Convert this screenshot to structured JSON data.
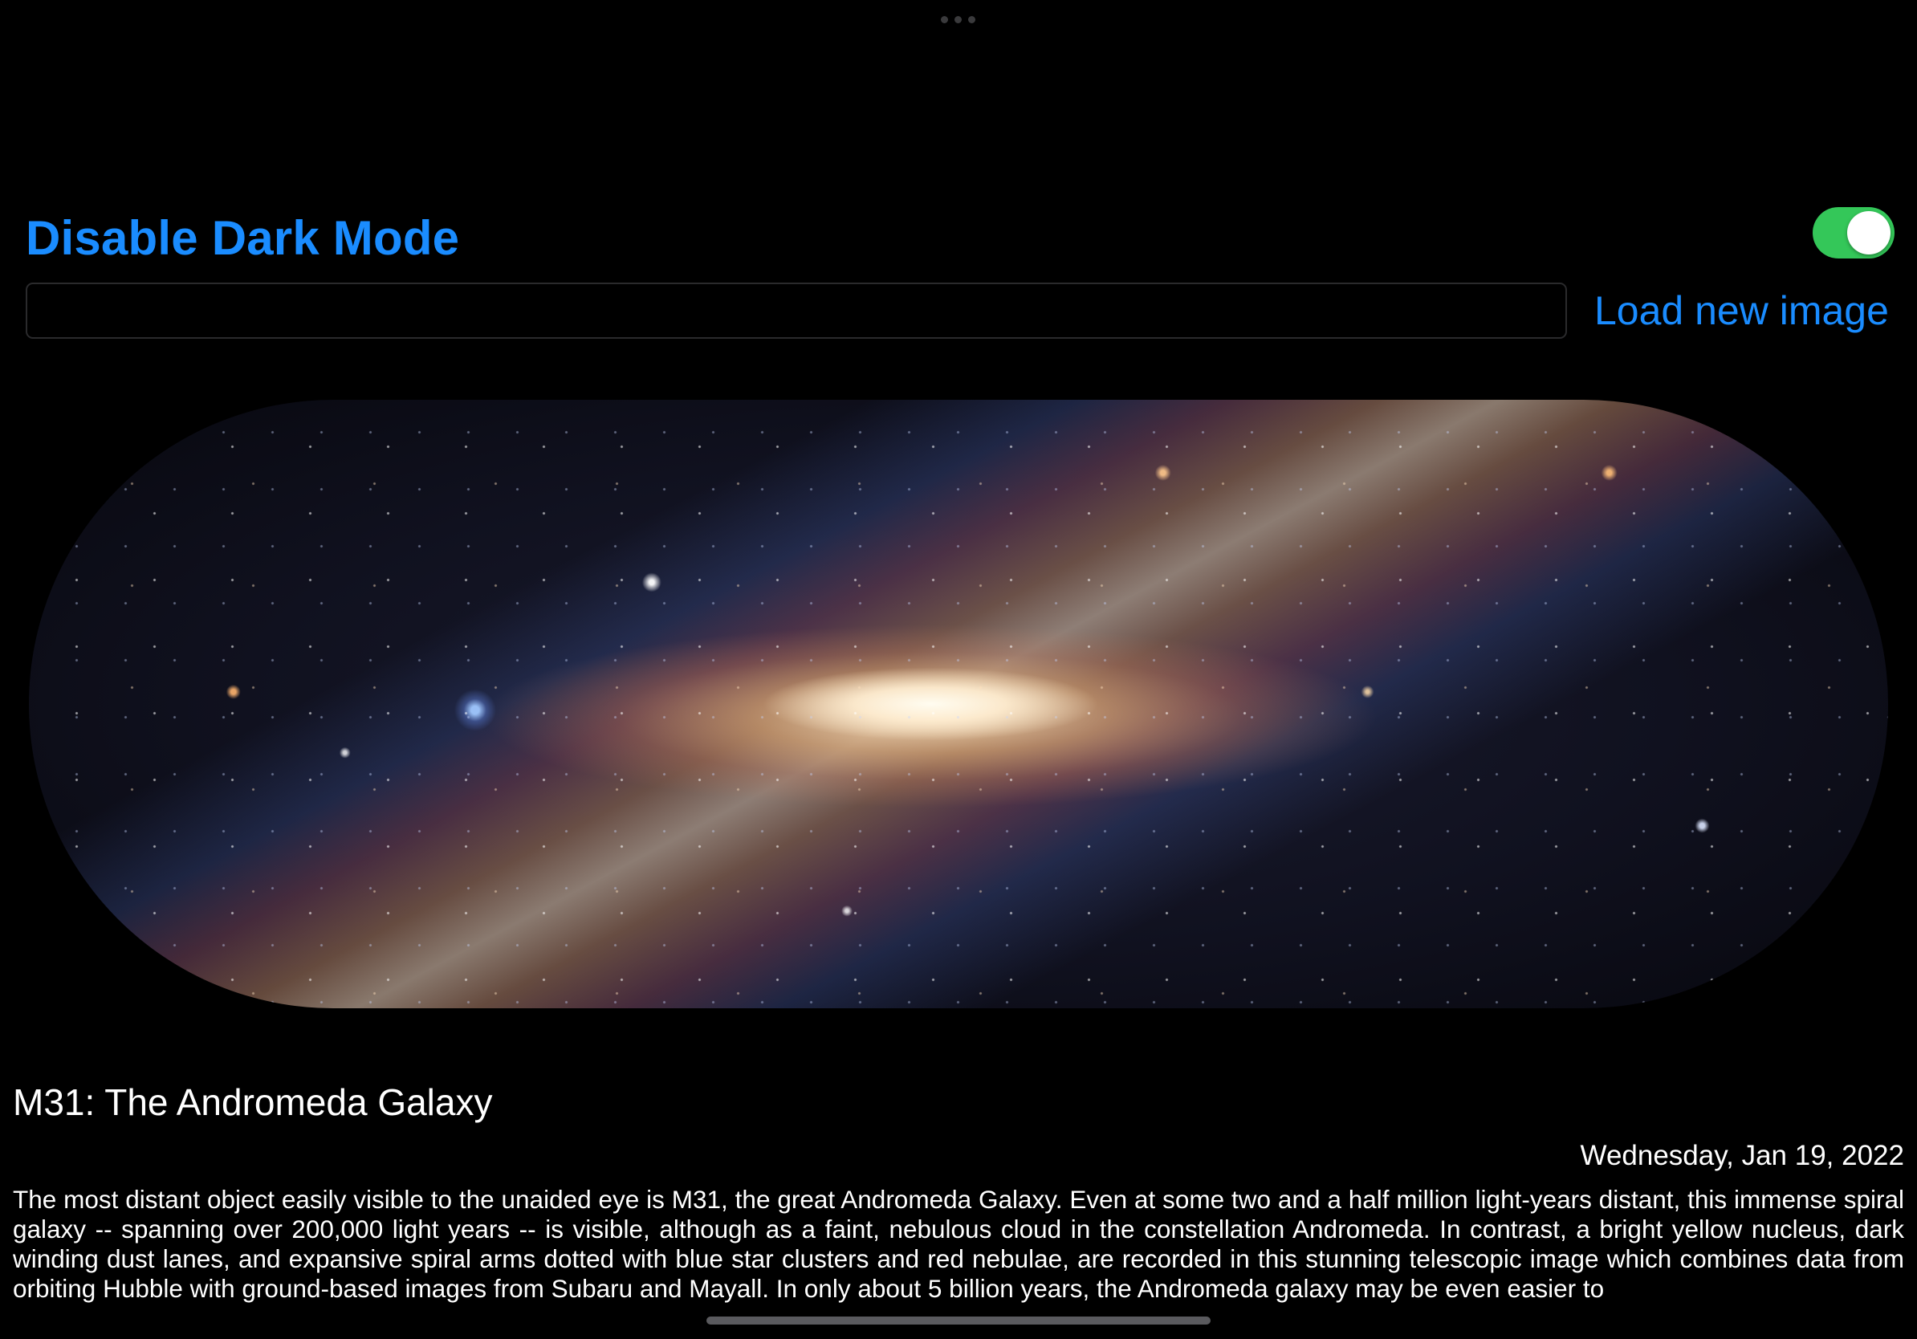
{
  "header": {
    "title": "Disable Dark Mode",
    "dark_mode_toggle_on": true,
    "toggle_color": "#34c759",
    "accent_color": "#1a8cff"
  },
  "image_loader": {
    "url_value": "",
    "load_button_label": "Load new image"
  },
  "image": {
    "description_icon": "galaxy-image"
  },
  "apod": {
    "title": "M31: The Andromeda Galaxy",
    "date": "Wednesday, Jan 19, 2022",
    "explanation": "The most distant object easily visible to the unaided eye is M31, the great Andromeda Galaxy. Even at some two and a half million light-years distant, this immense spiral galaxy -- spanning over 200,000 light years -- is visible, although as a faint, nebulous cloud in the constellation Andromeda. In contrast, a bright yellow nucleus, dark winding dust lanes, and expansive spiral arms dotted with blue star clusters and red nebulae, are recorded in this stunning telescopic image which combines data from orbiting Hubble with ground-based images from Subaru and Mayall. In only about 5 billion years, the Andromeda galaxy may be even easier to"
  }
}
